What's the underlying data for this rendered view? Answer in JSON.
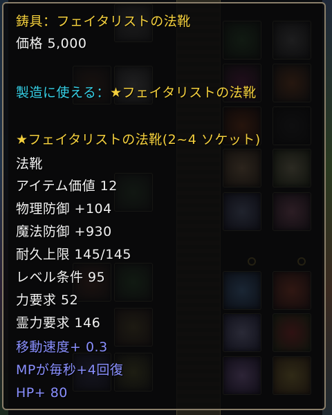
{
  "tooltip": {
    "item_name": "鋳具：フェイタリストの法靴",
    "price": "価格 5,000",
    "craft_label": "製造に使える：",
    "craft_item": "★フェイタリストの法靴",
    "result_name": "★フェイタリストの法靴(2~4 ソケット)",
    "stats": [
      "法靴",
      "アイテム価値 12",
      "物理防御 +104",
      "魔法防御 +930",
      "耐久上限 145/145",
      "レベル条件 95",
      "力要求 52",
      "霊力要求 146"
    ],
    "bonuses": [
      "移動速度+ 0.3",
      "MPが毎秒+4回復",
      "HP+ 80"
    ]
  },
  "colors": {
    "title": "#f4d03e",
    "craft": "#36d0e6",
    "stat": "#f2f2f2",
    "bonus": "#8a90ff",
    "border": "#8a7f6a"
  }
}
